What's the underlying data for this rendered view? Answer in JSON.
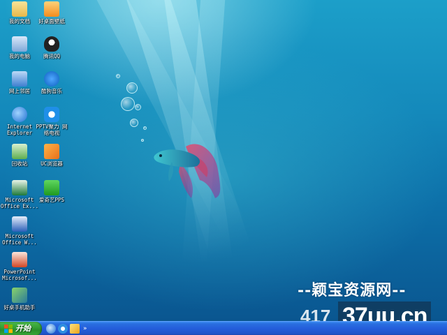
{
  "desktop": {
    "icons": [
      {
        "label": "我的文档",
        "icon": "folder-documents-icon",
        "color": "#f3d36b"
      },
      {
        "label": "好桌面壁纸",
        "icon": "wallpaper-app-icon",
        "color": "#f5a623"
      },
      {
        "label": "我的电脑",
        "icon": "computer-icon",
        "color": "#9fc4ef"
      },
      {
        "label": "腾讯QQ",
        "icon": "qq-penguin-icon",
        "color": "#222222"
      },
      {
        "label": "网上邻居",
        "icon": "network-places-icon",
        "color": "#6fa8e8"
      },
      {
        "label": "酷狗音乐",
        "icon": "kugou-music-icon",
        "color": "#1c7fe0"
      },
      {
        "label": "Internet\nExplorer",
        "icon": "internet-explorer-icon",
        "color": "#3a8ee6"
      },
      {
        "label": "PPTV聚力 网\n络电视",
        "icon": "pptv-icon",
        "color": "#1f8fe8"
      },
      {
        "label": "回收站",
        "icon": "recycle-bin-icon",
        "color": "#7fc66b"
      },
      {
        "label": "UC浏览器",
        "icon": "uc-browser-icon",
        "color": "#f28c1e"
      },
      {
        "label": "Microsoft\nOffice Ex...",
        "icon": "excel-icon",
        "color": "#1f7a3a"
      },
      {
        "label": "爱奇艺PPS",
        "icon": "iqiyi-icon",
        "color": "#2fb52f"
      },
      {
        "label": "Microsoft\nOffice W...",
        "icon": "word-icon",
        "color": "#2b5fb8"
      },
      {
        "label": "PowerPoint\nMicrosof...",
        "icon": "powerpoint-icon",
        "color": "#d24726"
      },
      {
        "label": "好桌手机助手",
        "icon": "phone-assistant-icon",
        "color": "#3a9a3a"
      }
    ]
  },
  "watermark": {
    "top_text": "--颖宝资源网--",
    "prefix": "417",
    "domain": "37uu.cn"
  },
  "taskbar": {
    "start_label": "开始",
    "quick_launch": [
      {
        "icon": "ie-quicklaunch-icon"
      },
      {
        "icon": "browser-quicklaunch-icon"
      },
      {
        "icon": "show-desktop-icon"
      }
    ],
    "more_glyph": "»"
  }
}
